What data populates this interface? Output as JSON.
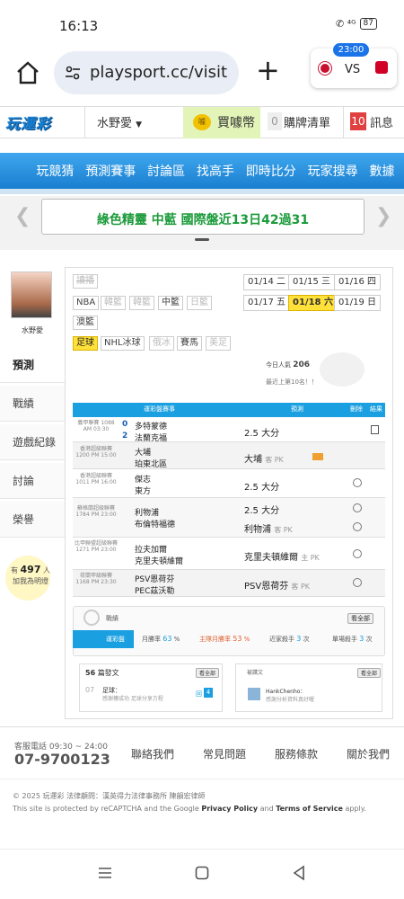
{
  "status_bar": {
    "time": "16:13",
    "icons": "✆ ⁴ᴳ",
    "battery": "87"
  },
  "browser": {
    "url": "playsport.cc/visit",
    "match_time": "23:00",
    "match_vs": "VS"
  },
  "site": {
    "logo": "玩運彩",
    "username": "水野愛",
    "coin_label": "買噱幣",
    "coin_icon": "噱",
    "cart_count": "0",
    "cart_label": "購牌清單",
    "msg_count": "10",
    "msg_label": "訊息"
  },
  "nav": [
    "玩競猜",
    "預測賽事",
    "討論區",
    "找高手",
    "即時比分",
    "玩家搜尋",
    "數據"
  ],
  "banner": "綠色精靈 中藍 國際盤近13日42過31",
  "sidebar": {
    "user": "水野愛",
    "items": [
      "預測",
      "戰績",
      "遊戲紀錄",
      "討論",
      "榮譽"
    ],
    "fans_prefix": "有",
    "fans_count": "497",
    "fans_suffix": "人",
    "fans_line2": "加我為明燈"
  },
  "leagues": {
    "row1": [
      "讀播",
      "NBA",
      "韓籃",
      "韓籃",
      "中籃",
      "日籃",
      "澳籃"
    ],
    "row2": [
      "足球",
      "NHL冰球",
      "俄冰",
      "賽馬",
      "美足"
    ]
  },
  "dates": [
    "01/14 二",
    "01/15 三",
    "01/16 四",
    "01/17 五",
    "01/18 六",
    "01/19 日"
  ],
  "stats": {
    "today": "今日人氣",
    "today_val": "206",
    "rank": "最近上第10名！！"
  },
  "table": {
    "headers": [
      "運彩盤賽事",
      "預測",
      "刪除",
      "結果"
    ],
    "rows": [
      {
        "league": "義甲聯賽 1088 AM 03:30",
        "score1": "0",
        "score2": "2",
        "team1": "多特蒙德",
        "team2": "法蘭克福",
        "pred1": "2.5 大分",
        "pred2": ""
      },
      {
        "league": "香港超級聯賽 1200 PM 15:00",
        "team1": "大埔",
        "team2": "珀東北區",
        "pred1": "大埔",
        "pred1_extra": "客 PK",
        "pred2": ""
      },
      {
        "league": "香港超級聯賽 1011 PM 16:00",
        "team1": "傑志",
        "team2": "東方",
        "pred1": "2.5 大分",
        "pred2": ""
      },
      {
        "league": "蘇格蘭超級聯賽 1784 PM 23:00",
        "team1": "利物浦",
        "team2": "布倫特福德",
        "pred1": "2.5 大分",
        "pred2": "利物浦",
        "pred2_extra": "客 PK"
      },
      {
        "league": "比甲聯盟超級聯賽 1271 PM 23:00",
        "team1": "拉夫加爾",
        "team2": "克里夫頓維爾",
        "pred1": "克里夫頓維爾",
        "pred1_extra": "主 PK",
        "pred2": ""
      },
      {
        "league": "荷蘭甲級聯賽 1168 PM 23:30",
        "team1": "PSV恩荷芬",
        "team2": "PEC茲沃勒",
        "pred1": "PSV恩荷芬",
        "pred1_extra": "客 PK",
        "pred2": ""
      }
    ]
  },
  "record": {
    "title": "戰績",
    "more": "看全部",
    "tab": "運彩盤",
    "month_label": "月勝率",
    "month_val": "63",
    "season_label": "主隊月勝率",
    "season_val": "53",
    "streak1_label": "近家殺手",
    "streak1_val": "3",
    "streak2_label": "單場殺手",
    "streak2_val": "3",
    "unit": "次",
    "pct": "%"
  },
  "posts": {
    "count": "56",
    "label": "篇發文",
    "more": "看全部",
    "post_num": "07",
    "post_title": "足球：",
    "post_sub": "感謝樓成功 足球分享方程",
    "reply_label": "回",
    "reply_count": "4"
  },
  "fans": {
    "label": "被讚文",
    "more": "看全部",
    "name": "HankChenho：",
    "sub": "感謝分析資料真好喔"
  },
  "footer": {
    "phone_label": "客服電話 09:30 ~ 24:00",
    "phone": "07-9700123",
    "links": [
      "聯絡我們",
      "常見問題",
      "服務條款",
      "關於我們"
    ],
    "copyright": "© 2025 玩運彩 法律顧問：漢英得力法律事務所 陳韻宏律師",
    "recaptcha_pre": "This site is protected by reCAPTCHA and the Google ",
    "privacy": "Privacy Policy",
    "and": " and ",
    "terms": "Terms of Service",
    "apply": " apply."
  }
}
